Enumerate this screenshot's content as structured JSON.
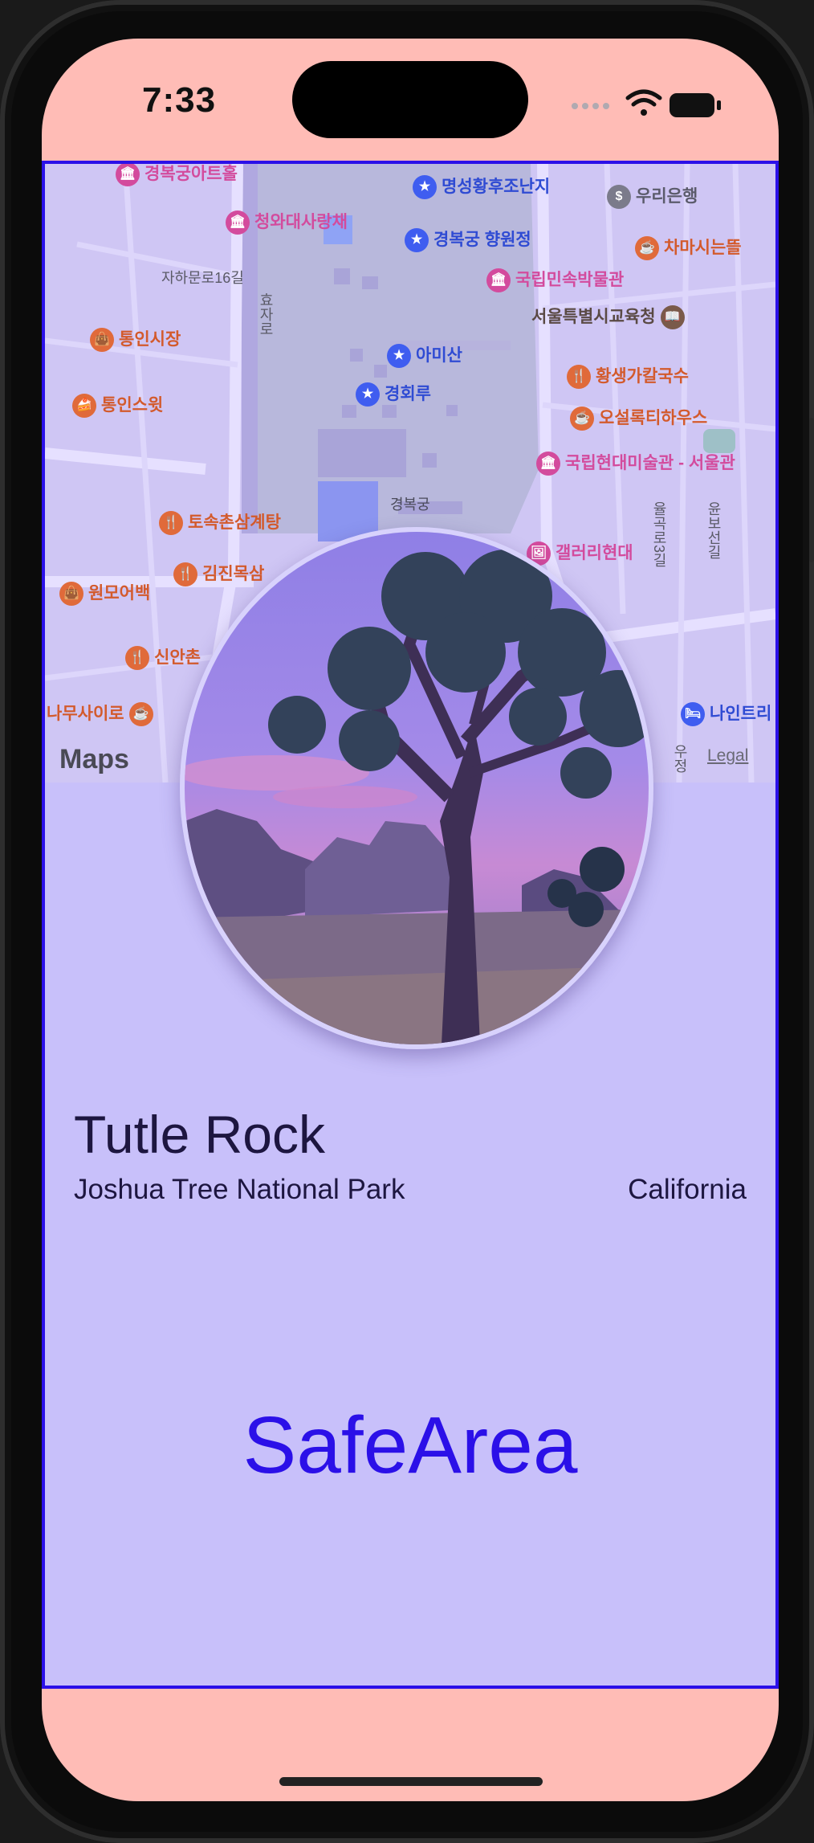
{
  "status_bar": {
    "time": "7:33"
  },
  "map": {
    "attribution": "Maps",
    "legal": "Legal",
    "labels": [
      {
        "text": "경복궁아트홀",
        "pin": "pink"
      },
      {
        "text": "명성황후조난지",
        "pin": "blue"
      },
      {
        "text": "우리은행",
        "pin": "gray"
      },
      {
        "text": "청와대사랑채",
        "pin": "pink"
      },
      {
        "text": "경복궁 향원정",
        "pin": "blue"
      },
      {
        "text": "차마시는뜰",
        "pin": "orange"
      },
      {
        "text": "자하문로16길",
        "pin": "none"
      },
      {
        "text": "효자로",
        "pin": "none"
      },
      {
        "text": "국립민속박물관",
        "pin": "pink"
      },
      {
        "text": "통인시장",
        "pin": "orange"
      },
      {
        "text": "서울특별시교육청",
        "pin": "brown"
      },
      {
        "text": "아미산",
        "pin": "blue"
      },
      {
        "text": "황생가칼국수",
        "pin": "orange"
      },
      {
        "text": "통인스윗",
        "pin": "orange"
      },
      {
        "text": "경회루",
        "pin": "blue"
      },
      {
        "text": "오설록티하우스",
        "pin": "orange"
      },
      {
        "text": "국립현대미술관 - 서울관",
        "pin": "pink"
      },
      {
        "text": "경복궁",
        "pin": "none"
      },
      {
        "text": "토속촌삼계탕",
        "pin": "orange"
      },
      {
        "text": "갤러리현대",
        "pin": "pink"
      },
      {
        "text": "김진목삼",
        "pin": "orange"
      },
      {
        "text": "원모어백",
        "pin": "orange"
      },
      {
        "text": "율곡로3길",
        "pin": "none"
      },
      {
        "text": "윤보선길",
        "pin": "none"
      },
      {
        "text": "신안촌",
        "pin": "orange"
      },
      {
        "text": "나무사이로",
        "pin": "orange"
      },
      {
        "text": "나인트리",
        "pin": "blue"
      },
      {
        "text": "우정",
        "pin": "none"
      }
    ]
  },
  "landmark": {
    "name": "Tutle Rock",
    "park": "Joshua Tree National Park",
    "state": "California"
  },
  "overlay": {
    "label": "SafeArea"
  },
  "colors": {
    "safe_area_border": "#2b10e8",
    "safe_area_fill": "#c8c0fa",
    "outside_fill": "#ffbcb6"
  }
}
